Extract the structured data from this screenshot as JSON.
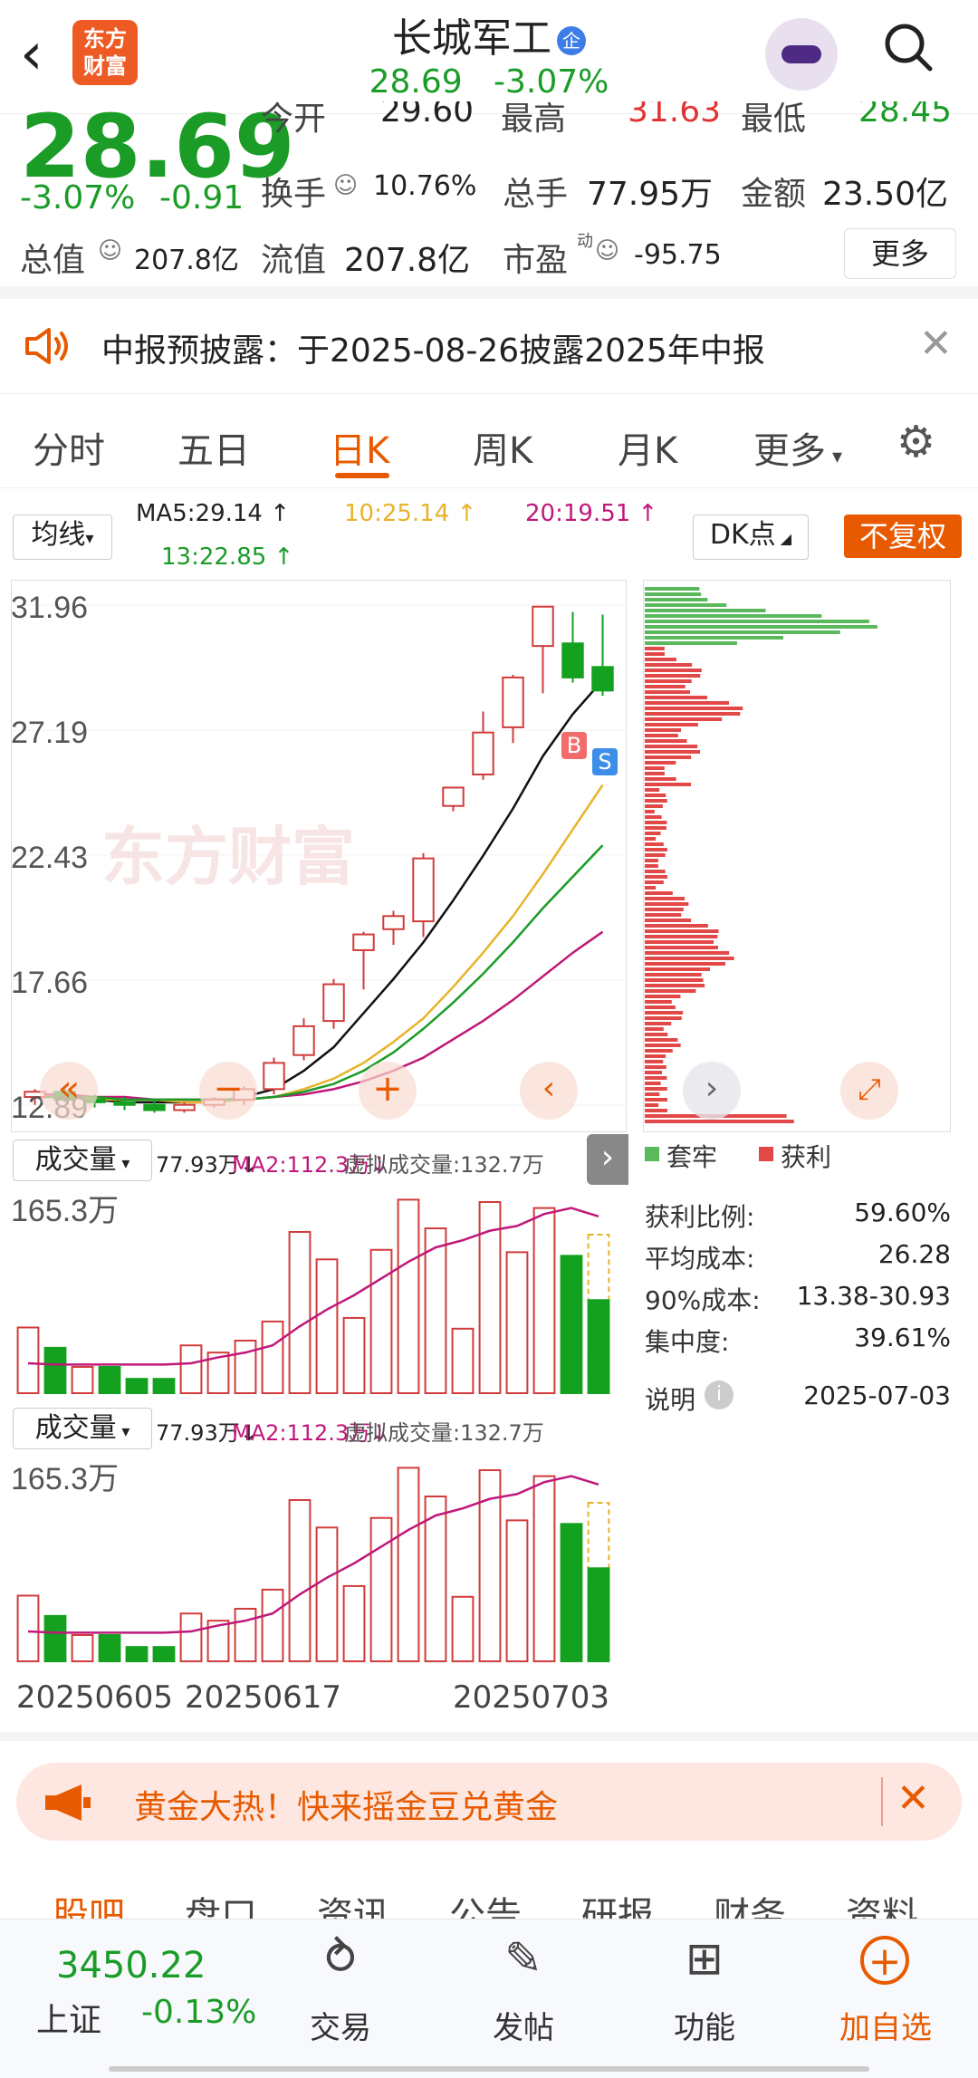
{
  "header": {
    "stock_name": "长城军工",
    "badge": "企",
    "price": "28.69",
    "change_pct": "-3.07%",
    "logo_line1": "东方",
    "logo_line2": "财富"
  },
  "quote": {
    "price": "28.69",
    "change_pct": "-3.07%",
    "change": "-0.91",
    "open_label": "今开",
    "open": "29.60",
    "high_label": "最高",
    "high": "31.63",
    "low_label": "最低",
    "low": "28.45",
    "turnover_label": "换手",
    "turnover": "10.76%",
    "volume_label": "总手",
    "volume": "77.95万",
    "amount_label": "金额",
    "amount": "23.50亿",
    "mktcap_label": "总值",
    "mktcap": "207.8亿",
    "float_label": "流值",
    "float": "207.8亿",
    "pe_label": "市盈",
    "pe_sup": "动",
    "pe": "-95.75",
    "more": "更多"
  },
  "notice": {
    "text": "中报预披露：于2025-08-26披露2025年中报"
  },
  "tabs": [
    "分时",
    "五日",
    "日K",
    "周K",
    "月K",
    "更多"
  ],
  "ma": {
    "selector": "均线",
    "ma5": "MA5:29.14 ↑",
    "ma10": "10:25.14 ↑",
    "ma20": "20:19.51 ↑",
    "ma13": "13:22.85 ↑",
    "dk": "DK点",
    "fq": "不复权"
  },
  "chart_data": {
    "type": "candlestick",
    "y_ticks": [
      "31.96",
      "27.19",
      "22.43",
      "17.66",
      "12.89"
    ],
    "ylim": [
      12.89,
      31.96
    ],
    "candles": [
      {
        "o": 13.2,
        "h": 13.5,
        "l": 12.9,
        "c": 13.4,
        "up": true
      },
      {
        "o": 13.4,
        "h": 13.6,
        "l": 13.0,
        "c": 13.1,
        "up": false
      },
      {
        "o": 13.1,
        "h": 13.3,
        "l": 12.8,
        "c": 13.0,
        "up": false
      },
      {
        "o": 13.0,
        "h": 13.2,
        "l": 12.7,
        "c": 12.9,
        "up": false
      },
      {
        "o": 12.9,
        "h": 13.1,
        "l": 12.6,
        "c": 12.7,
        "up": false
      },
      {
        "o": 12.7,
        "h": 13.0,
        "l": 12.6,
        "c": 12.9,
        "up": true
      },
      {
        "o": 12.9,
        "h": 13.2,
        "l": 12.8,
        "c": 13.1,
        "up": true
      },
      {
        "o": 13.1,
        "h": 13.6,
        "l": 12.9,
        "c": 13.5,
        "up": true
      },
      {
        "o": 13.5,
        "h": 14.7,
        "l": 13.3,
        "c": 14.5,
        "up": true
      },
      {
        "o": 14.8,
        "h": 16.2,
        "l": 14.6,
        "c": 15.9,
        "up": true
      },
      {
        "o": 16.1,
        "h": 17.7,
        "l": 15.8,
        "c": 17.5,
        "up": true
      },
      {
        "o": 18.8,
        "h": 19.5,
        "l": 17.3,
        "c": 19.4,
        "up": true
      },
      {
        "o": 19.6,
        "h": 20.3,
        "l": 19.0,
        "c": 20.1,
        "up": true
      },
      {
        "o": 19.9,
        "h": 22.5,
        "l": 19.3,
        "c": 22.3,
        "up": true
      },
      {
        "o": 24.3,
        "h": 25.0,
        "l": 24.1,
        "c": 25.0,
        "up": true
      },
      {
        "o": 25.5,
        "h": 27.9,
        "l": 25.3,
        "c": 27.1,
        "up": true
      },
      {
        "o": 27.3,
        "h": 29.3,
        "l": 26.7,
        "c": 29.2,
        "up": true
      },
      {
        "o": 30.4,
        "h": 31.9,
        "l": 28.6,
        "c": 31.9,
        "up": true
      },
      {
        "o": 30.5,
        "h": 31.7,
        "l": 29.0,
        "c": 29.2,
        "up": false
      },
      {
        "o": 29.6,
        "h": 31.6,
        "l": 28.5,
        "c": 28.7,
        "up": false
      }
    ],
    "ma_lines": {
      "ma5": [
        13.2,
        13.2,
        13.1,
        13.0,
        13.0,
        13.0,
        13.0,
        13.2,
        13.5,
        14.2,
        15.1,
        16.4,
        17.7,
        19.1,
        20.7,
        22.4,
        24.2,
        26.2,
        27.8,
        29.1
      ],
      "ma10": [
        13.2,
        13.2,
        13.1,
        13.1,
        13.1,
        13.0,
        13.0,
        13.1,
        13.2,
        13.5,
        13.9,
        14.5,
        15.3,
        16.2,
        17.4,
        18.7,
        20.1,
        21.7,
        23.4,
        25.1
      ],
      "ma20": [
        13.3,
        13.3,
        13.2,
        13.2,
        13.1,
        13.1,
        13.1,
        13.1,
        13.2,
        13.3,
        13.5,
        13.8,
        14.2,
        14.7,
        15.4,
        16.1,
        16.9,
        17.8,
        18.7,
        19.5
      ],
      "ma13": [
        13.2,
        13.2,
        13.2,
        13.1,
        13.1,
        13.1,
        13.1,
        13.1,
        13.2,
        13.4,
        13.7,
        14.2,
        14.9,
        15.8,
        16.8,
        17.9,
        19.1,
        20.4,
        21.6,
        22.8
      ]
    },
    "volume": {
      "ymax_label": "165.3万",
      "values": [
        55,
        38,
        22,
        22,
        12,
        12,
        40,
        34,
        44,
        60,
        135,
        112,
        63,
        120,
        162,
        138,
        54,
        160,
        118,
        155,
        115,
        77.9
      ],
      "up": [
        true,
        false,
        true,
        false,
        false,
        false,
        true,
        true,
        true,
        true,
        true,
        true,
        true,
        true,
        true,
        true,
        true,
        true,
        true,
        true,
        false,
        false
      ],
      "ma2": [
        25,
        24,
        24,
        24,
        24,
        24,
        25,
        30,
        34,
        40,
        56,
        70,
        82,
        96,
        110,
        122,
        128,
        136,
        140,
        150,
        155,
        148
      ]
    },
    "x_ticks": [
      "20250605",
      "20250617",
      "20250703"
    ]
  },
  "chip": {
    "legend_hold": "套牢",
    "legend_profit": "获利",
    "rows": [
      {
        "label": "获利比例:",
        "value": "59.60%"
      },
      {
        "label": "平均成本:",
        "value": "26.28"
      },
      {
        "label": "90%成本:",
        "value": "13.38-30.93"
      },
      {
        "label": "集中度:",
        "value": "39.61%"
      }
    ],
    "note_label": "说明",
    "date": "2025-07-03"
  },
  "volume_panel": {
    "selector": "成交量",
    "vol": "77.93万↓",
    "ma2": "MA2:112.3万↓",
    "virtual": "虚拟成交量:132.7万"
  },
  "banner": {
    "text": "黄金大热！快来摇金豆兑黄金"
  },
  "bottom_tabs": [
    "股吧",
    "盘口",
    "资讯",
    "公告",
    "研报",
    "财务",
    "资料"
  ],
  "bottom_nav": {
    "index_value": "3450.22",
    "index_name": "上证",
    "index_change": "-0.13%",
    "items": [
      "交易",
      "发帖",
      "功能",
      "加自选"
    ]
  }
}
